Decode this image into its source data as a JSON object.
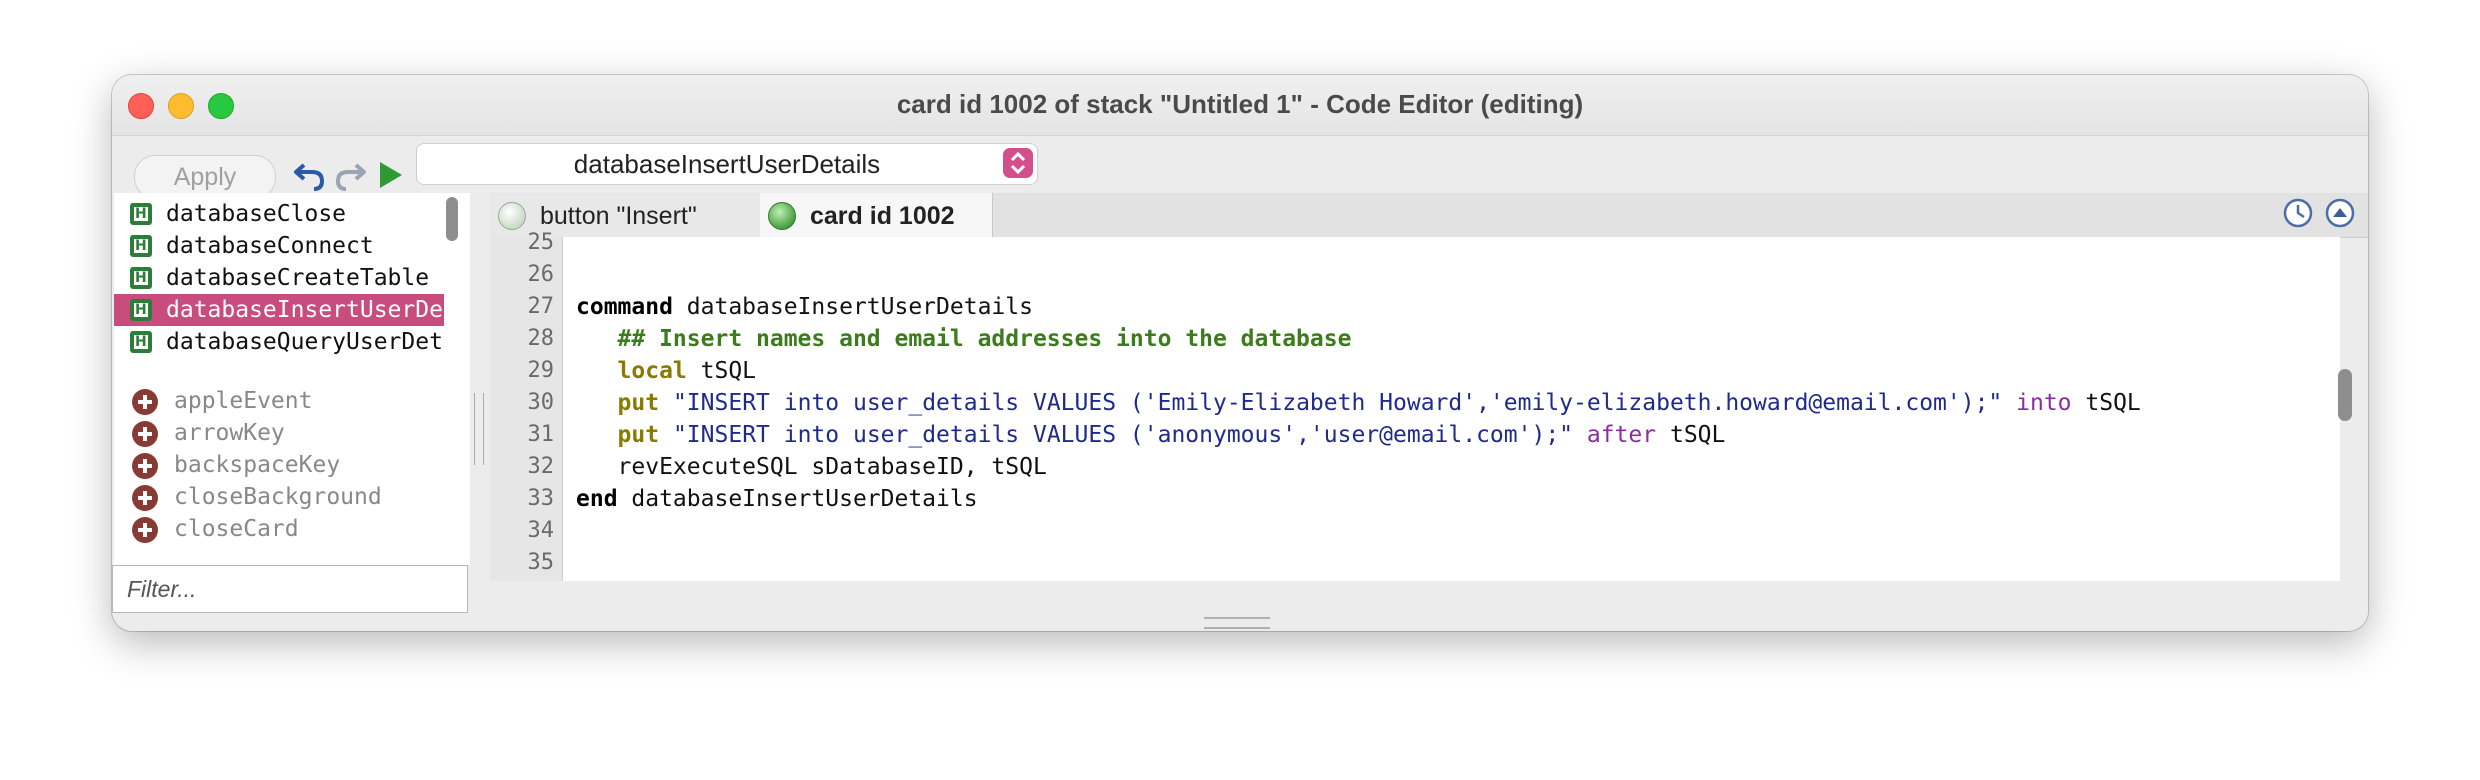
{
  "window": {
    "title": "card id 1002 of stack \"Untitled 1\" - Code Editor (editing)"
  },
  "toolbar": {
    "apply_label": "Apply",
    "handler_select_value": "databaseInsertUserDetails"
  },
  "sidebar": {
    "handlers": [
      {
        "label": "databaseClose",
        "selected": false
      },
      {
        "label": "databaseConnect",
        "selected": false
      },
      {
        "label": "databaseCreateTable",
        "selected": false
      },
      {
        "label": "databaseInsertUserDetails",
        "selected": true
      },
      {
        "label": "databaseQueryUserDetails",
        "selected": false
      }
    ],
    "messages": [
      "appleEvent",
      "arrowKey",
      "backspaceKey",
      "closeBackground",
      "closeCard"
    ],
    "filter_placeholder": "Filter..."
  },
  "tabs": [
    {
      "label": "button \"Insert\"",
      "active": false
    },
    {
      "label": "card id 1002",
      "active": true
    }
  ],
  "editor": {
    "line_numbers": [
      "25",
      "26",
      "27",
      "28",
      "29",
      "30",
      "31",
      "32",
      "33",
      "34",
      "35"
    ],
    "lines": [
      {
        "n": "25",
        "tokens": []
      },
      {
        "n": "26",
        "tokens": []
      },
      {
        "n": "27",
        "tokens": [
          {
            "t": "command",
            "c": "kw-black"
          },
          {
            "t": " databaseInsertUserDetails",
            "c": ""
          }
        ]
      },
      {
        "n": "28",
        "tokens": [
          {
            "t": "   ## Insert names and email addresses into the database",
            "c": "comment"
          }
        ]
      },
      {
        "n": "29",
        "tokens": [
          {
            "t": "   ",
            "c": ""
          },
          {
            "t": "local",
            "c": "kw-olive"
          },
          {
            "t": " tSQL",
            "c": ""
          }
        ]
      },
      {
        "n": "30",
        "tokens": [
          {
            "t": "   ",
            "c": ""
          },
          {
            "t": "put",
            "c": "kw-olive"
          },
          {
            "t": " ",
            "c": ""
          },
          {
            "t": "\"INSERT into user_details VALUES ('Emily-Elizabeth Howard','emily-elizabeth.howard@email.com');\"",
            "c": "str"
          },
          {
            "t": " ",
            "c": ""
          },
          {
            "t": "into",
            "c": "kw-purple"
          },
          {
            "t": " tSQL",
            "c": ""
          }
        ]
      },
      {
        "n": "31",
        "tokens": [
          {
            "t": "   ",
            "c": ""
          },
          {
            "t": "put",
            "c": "kw-olive"
          },
          {
            "t": " ",
            "c": ""
          },
          {
            "t": "\"INSERT into user_details VALUES ('anonymous','user@email.com');\"",
            "c": "str"
          },
          {
            "t": " ",
            "c": ""
          },
          {
            "t": "after",
            "c": "kw-purple"
          },
          {
            "t": " tSQL",
            "c": ""
          }
        ]
      },
      {
        "n": "32",
        "tokens": [
          {
            "t": "   revExecuteSQL sDatabaseID, tSQL",
            "c": ""
          }
        ]
      },
      {
        "n": "33",
        "tokens": [
          {
            "t": "end",
            "c": "kw-black"
          },
          {
            "t": " databaseInsertUserDetails",
            "c": ""
          }
        ]
      },
      {
        "n": "34",
        "tokens": []
      },
      {
        "n": "35",
        "tokens": []
      }
    ]
  },
  "colors": {
    "selection": "#c94c7f",
    "select_arrows": "#d44f8a",
    "handler_badge": "#2d7d3a",
    "message_icon": "#8a3a34"
  },
  "icons": {
    "undo": "undo-icon",
    "redo": "redo-icon",
    "run": "run-icon",
    "history": "clock-icon",
    "collapse": "collapse-up-icon"
  }
}
